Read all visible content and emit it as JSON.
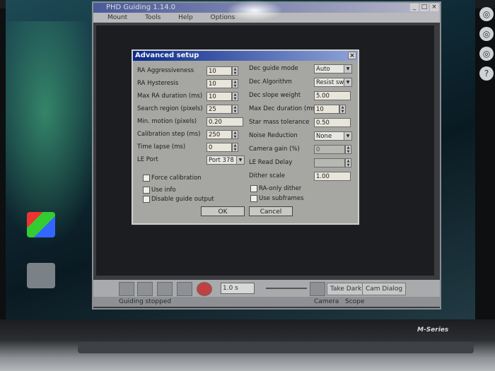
{
  "app": {
    "title": "PHD Guiding 1.14.0",
    "menu": [
      "Mount",
      "Tools",
      "Help",
      "Options"
    ]
  },
  "dialog": {
    "title": "Advanced setup",
    "close_glyph": "×",
    "left": [
      {
        "label": "RA Aggressiveness",
        "value": "10",
        "type": "spin"
      },
      {
        "label": "RA Hysteresis",
        "value": "10",
        "type": "spin"
      },
      {
        "label": "Max RA duration (ms)",
        "value": "10",
        "type": "spin"
      },
      {
        "label": "Search region (pixels)",
        "value": "25",
        "type": "spin"
      },
      {
        "label": "Min. motion (pixels)",
        "value": "0.20",
        "type": "text"
      },
      {
        "label": "Calibration step (ms)",
        "value": "250",
        "type": "spin"
      },
      {
        "label": "Time lapse (ms)",
        "value": "0",
        "type": "spin"
      },
      {
        "label": "LE Port",
        "value": "Port 378",
        "type": "select"
      }
    ],
    "right": [
      {
        "label": "Dec guide mode",
        "value": "Auto",
        "type": "select"
      },
      {
        "label": "Dec Algorithm",
        "value": "Resist sw",
        "type": "select"
      },
      {
        "label": "Dec slope weight",
        "value": "5.00",
        "type": "text"
      },
      {
        "label": "Max Dec duration (ms)",
        "value": "10",
        "type": "spin"
      },
      {
        "label": "Star mass tolerance",
        "value": "0.50",
        "type": "text"
      },
      {
        "label": "Noise Reduction",
        "value": "None",
        "type": "select"
      },
      {
        "label": "Camera gain (%)",
        "value": "0",
        "type": "spin-disabled"
      },
      {
        "label": "LE Read Delay",
        "value": "",
        "type": "spin-disabled"
      },
      {
        "label": "Dither scale",
        "value": "1.00",
        "type": "text"
      }
    ],
    "checks_left": [
      "Force calibration",
      "Use info",
      "Disable guide output"
    ],
    "checks_right": [
      "RA-only dither",
      "Use subframes"
    ],
    "ok_label": "OK",
    "cancel_label": "Cancel"
  },
  "toolbar": {
    "exposure": "1.0 s",
    "take_dark": "Take Dark",
    "cam_dialog": "Cam Dialog"
  },
  "status": {
    "left": "Guiding stopped",
    "camera": "Camera",
    "scope": "Scope"
  },
  "laptop": {
    "brand": "M-Series"
  },
  "colors": {
    "dialog_title_start": "#0a2a8a",
    "dialog_bg": "#a6a6a2",
    "field_bg": "#e8e5da"
  }
}
